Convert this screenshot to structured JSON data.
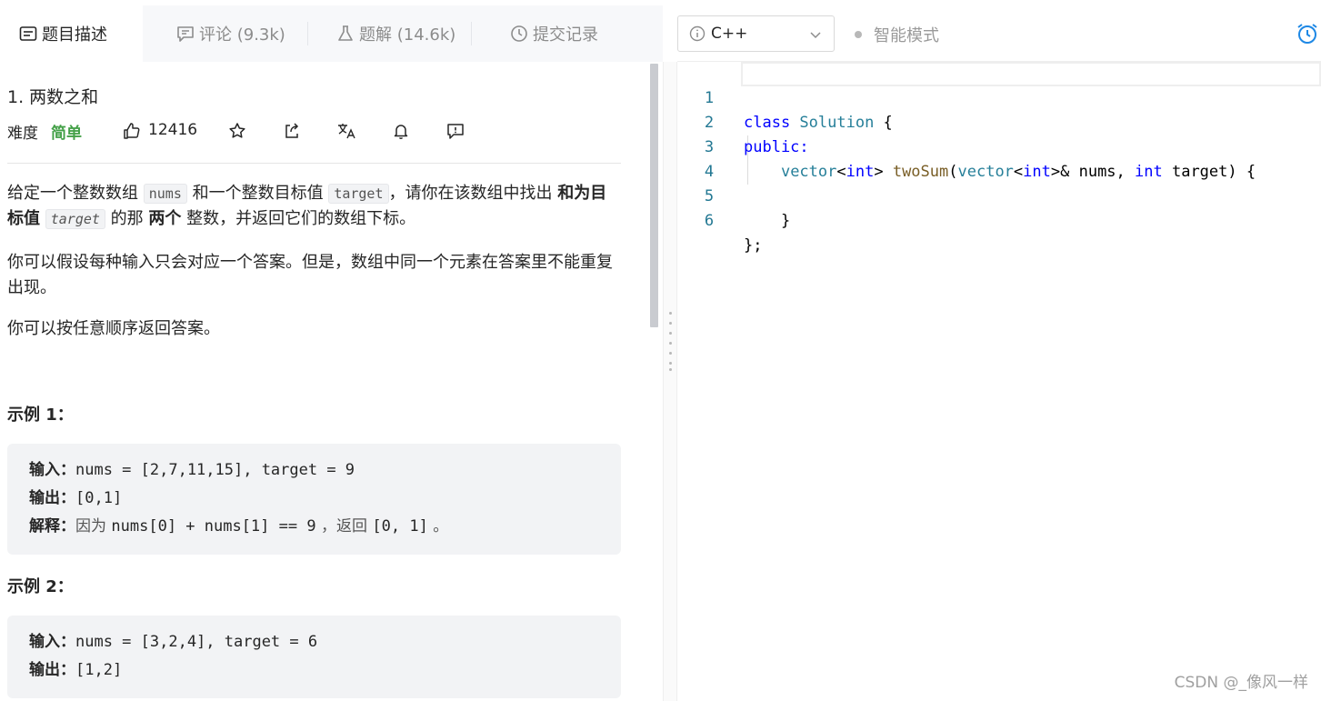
{
  "tabs": [
    {
      "label": "题目描述",
      "icon": "description-icon",
      "active": true
    },
    {
      "label": "评论 (9.3k)",
      "icon": "comment-icon",
      "active": false
    },
    {
      "label": "题解 (14.6k)",
      "icon": "flask-icon",
      "active": false
    },
    {
      "label": "提交记录",
      "icon": "clock-icon",
      "active": false
    }
  ],
  "problem": {
    "title": "1. 两数之和",
    "difficulty_label": "难度",
    "difficulty_value": "简单",
    "likes": "12416"
  },
  "description": {
    "p1": {
      "a": "给定一个整数数组 ",
      "code1": "nums",
      "b": " 和一个整数目标值 ",
      "code2": "target",
      "c": "，请你在该数组中找出 ",
      "bold1": "和为目标值",
      "d": " ",
      "code3": "target",
      "e": " 的那 ",
      "bold2": "两个",
      "f": " 整数，并返回它们的数组下标。"
    },
    "p2": "你可以假设每种输入只会对应一个答案。但是，数组中同一个元素在答案里不能重复出现。",
    "p3": "你可以按任意顺序返回答案。"
  },
  "examples": [
    {
      "title": "示例 1：",
      "input_label": "输入：",
      "input": "nums = [2,7,11,15], target = 9",
      "output_label": "输出：",
      "output": "[0,1]",
      "explain_label": "解释：",
      "explain_a": "因为 ",
      "explain_code1": "nums[0] + nums[1] == 9",
      "explain_b": " ，返回 ",
      "explain_code2": "[0, 1]",
      "explain_c": " 。"
    },
    {
      "title": "示例 2：",
      "input_label": "输入：",
      "input": "nums = [3,2,4], target = 6",
      "output_label": "输出：",
      "output": "[1,2]"
    }
  ],
  "editor": {
    "language": "C++",
    "smart_mode": "智能模式",
    "line_numbers": [
      "1",
      "2",
      "3",
      "4",
      "5",
      "6"
    ],
    "code": {
      "l1_kw": "class",
      "l1_ty": " Solution",
      "l1_pl": " {",
      "l2_kw": "public:",
      "l3_indent": "    ",
      "l3_ty1": "vector",
      "l3_p1": "<",
      "l3_kw1": "int",
      "l3_p2": "> ",
      "l3_fn": "twoSum",
      "l3_p3": "(",
      "l3_ty2": "vector",
      "l3_p4": "<",
      "l3_kw2": "int",
      "l3_p5": ">& nums, ",
      "l3_kw3": "int",
      "l3_p6": " target) {",
      "l5": "    }",
      "l6": "};"
    }
  },
  "watermark": "CSDN @_像风一样",
  "colors": {
    "easy": "#43a047",
    "keyword": "#0000ff",
    "type": "#267f99",
    "function": "#795e26",
    "line_number": "#237893",
    "accent": "#1e88e5"
  }
}
